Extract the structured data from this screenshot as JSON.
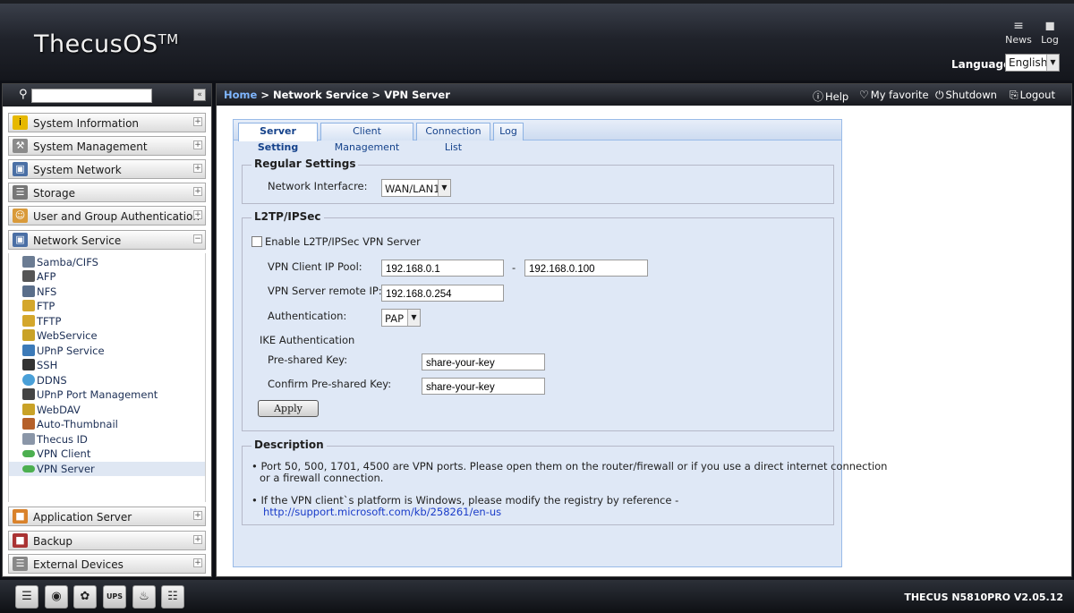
{
  "header": {
    "logo_text": "ThecusOS",
    "logo_tm": "TM",
    "news_label": "News",
    "log_label": "Log",
    "language_label": "Language:",
    "language_value": "English"
  },
  "sidebar": {
    "search": {
      "value": "",
      "placeholder": ""
    },
    "collapse_glyph": "«",
    "categories_top": [
      {
        "label": "System Information",
        "toggle": "+"
      },
      {
        "label": "System Management",
        "toggle": "+"
      },
      {
        "label": "System Network",
        "toggle": "+"
      },
      {
        "label": "Storage",
        "toggle": "+"
      },
      {
        "label": "User and Group Authentication",
        "toggle": "+"
      },
      {
        "label": "Network Service",
        "toggle": "−"
      }
    ],
    "sub_items": [
      {
        "label": "Samba/CIFS"
      },
      {
        "label": "AFP"
      },
      {
        "label": "NFS"
      },
      {
        "label": "FTP"
      },
      {
        "label": "TFTP"
      },
      {
        "label": "WebService"
      },
      {
        "label": "UPnP Service"
      },
      {
        "label": "SSH"
      },
      {
        "label": "DDNS"
      },
      {
        "label": "UPnP Port Management"
      },
      {
        "label": "WebDAV"
      },
      {
        "label": "Auto-Thumbnail"
      },
      {
        "label": "Thecus ID"
      },
      {
        "label": "VPN Client"
      },
      {
        "label": "VPN Server",
        "active": true
      }
    ],
    "categories_bottom": [
      {
        "label": "Application Server",
        "toggle": "+"
      },
      {
        "label": "Backup",
        "toggle": "+"
      },
      {
        "label": "External Devices",
        "toggle": "+"
      }
    ]
  },
  "breadcrumb": {
    "home": "Home",
    "sep": " > ",
    "level1": "Network Service",
    "level2": "VPN Server"
  },
  "toolbar": {
    "help": "Help",
    "favorite": "My favorite",
    "shutdown": "Shutdown",
    "logout": "Logout"
  },
  "tabs": [
    {
      "label": "Server Setting",
      "active": true
    },
    {
      "label": "Client Management"
    },
    {
      "label": "Connection List"
    },
    {
      "label": "Log"
    }
  ],
  "regular": {
    "legend": "Regular Settings",
    "interface_label": "Network Interfacre:",
    "interface_value": "WAN/LAN1"
  },
  "l2tp": {
    "legend": "L2TP/IPSec",
    "enable_label": "Enable L2TP/IPSec VPN Server",
    "enable_checked": false,
    "pool_label": "VPN Client IP Pool:",
    "pool_start": "192.168.0.1",
    "pool_dash": "-",
    "pool_end": "192.168.0.100",
    "remote_ip_label": "VPN Server remote IP:",
    "remote_ip": "192.168.0.254",
    "auth_label": "Authentication:",
    "auth_value": "PAP",
    "ike_label": "IKE Authentication",
    "psk_label": "Pre-shared Key:",
    "psk_value": "share-your-key",
    "psk_confirm_label": "Confirm Pre-shared Key:",
    "psk_confirm_value": "share-your-key",
    "apply_label": "Apply"
  },
  "description": {
    "legend": "Description",
    "line1": "•  Port 50, 500, 1701, 4500 are VPN ports. Please open them on the router/firewall or if you use a direct internet connection",
    "line1b": "or a firewall connection.",
    "line2": "•  If the VPN client`s platform is Windows, please modify the registry by reference -",
    "link": "http://support.microsoft.com/kb/258261/en-us"
  },
  "footer": {
    "ups_label": "UPS",
    "version": "THECUS N5810PRO V2.05.12"
  }
}
